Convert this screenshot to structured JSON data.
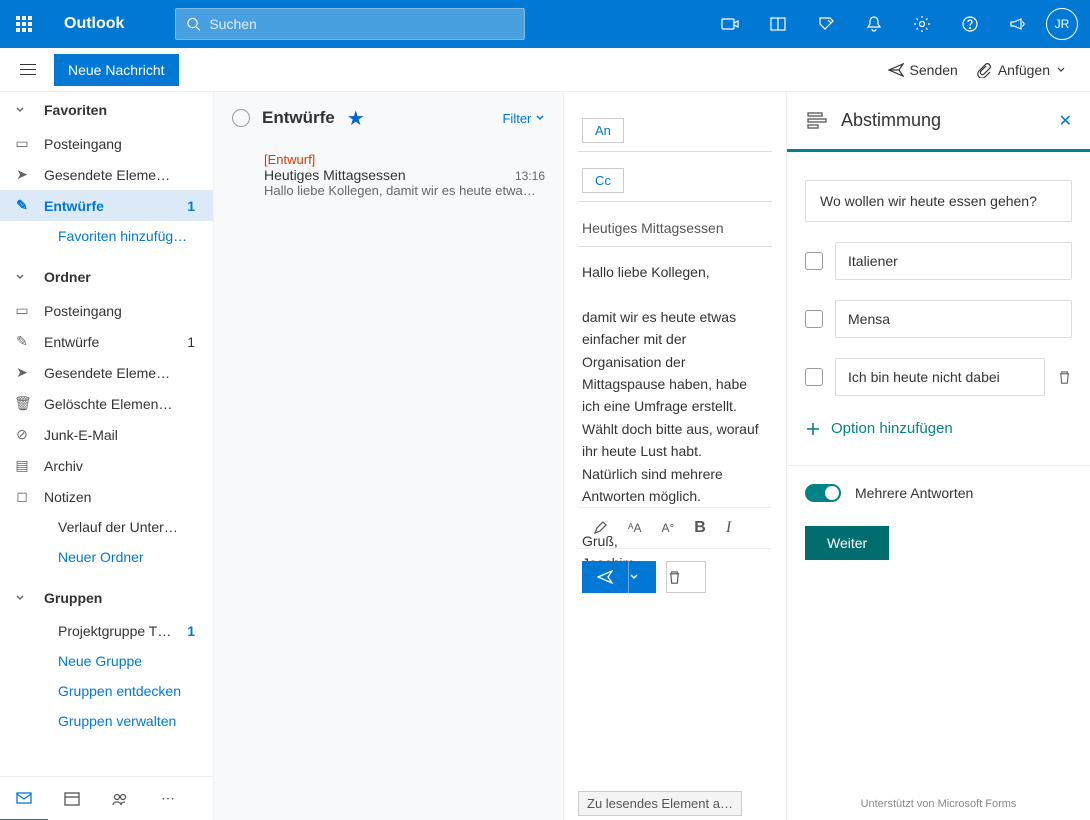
{
  "header": {
    "app": "Outlook",
    "search_placeholder": "Suchen",
    "avatar": "JR"
  },
  "commands": {
    "new_message": "Neue Nachricht",
    "send": "Senden",
    "attach": "Anfügen"
  },
  "sidebar": {
    "favorites": {
      "title": "Favoriten",
      "items": [
        {
          "label": "Posteingang",
          "count": ""
        },
        {
          "label": "Gesendete Eleme…",
          "count": ""
        },
        {
          "label": "Entwürfe",
          "count": "1",
          "active": true
        },
        {
          "label": "Favoriten hinzufüg…",
          "link": true
        }
      ]
    },
    "folders": {
      "title": "Ordner",
      "items": [
        {
          "label": "Posteingang"
        },
        {
          "label": "Entwürfe",
          "count": "1"
        },
        {
          "label": "Gesendete Eleme…"
        },
        {
          "label": "Gelöschte Elemen…"
        },
        {
          "label": "Junk-E-Mail"
        },
        {
          "label": "Archiv"
        },
        {
          "label": "Notizen"
        },
        {
          "label": "Verlauf der Unter…"
        },
        {
          "label": "Neuer Ordner",
          "link": true
        }
      ]
    },
    "groups": {
      "title": "Gruppen",
      "items": [
        {
          "label": "Projektgruppe T…",
          "count": "1"
        },
        {
          "label": "Neue Gruppe",
          "link": true
        },
        {
          "label": "Gruppen entdecken",
          "link": true
        },
        {
          "label": "Gruppen verwalten",
          "link": true
        }
      ]
    }
  },
  "msglist": {
    "folder": "Entwürfe",
    "filter": "Filter",
    "item": {
      "draft_label": "[Entwurf]",
      "subject": "Heutiges Mittagsessen",
      "time": "13:16",
      "preview": "Hallo liebe Kollegen, damit wir es heute etwa…"
    }
  },
  "compose": {
    "to": "An",
    "cc": "Cc",
    "subject": "Heutiges Mittagsessen",
    "body_greeting": "Hallo liebe Kollegen,",
    "body_p1": "damit wir es heute etwas einfacher mit der Organisation der Mittagspause haben, habe ich eine Umfrage erstellt.",
    "body_p2": "Wählt doch bitte aus, worauf ihr heute Lust habt.",
    "body_p3": "Natürlich sind mehrere Antworten möglich.",
    "body_sign1": "Gruß,",
    "body_sign2": "Joachim",
    "footer": "Zu lesendes Element a…"
  },
  "poll": {
    "title": "Abstimmung",
    "question": "Wo wollen wir heute essen gehen?",
    "options": [
      "Italiener",
      "Mensa",
      "Ich bin heute nicht dabei"
    ],
    "add_option": "Option hinzufügen",
    "multi": "Mehrere Antworten",
    "next": "Weiter",
    "footer": "Unterstützt von Microsoft Forms"
  }
}
